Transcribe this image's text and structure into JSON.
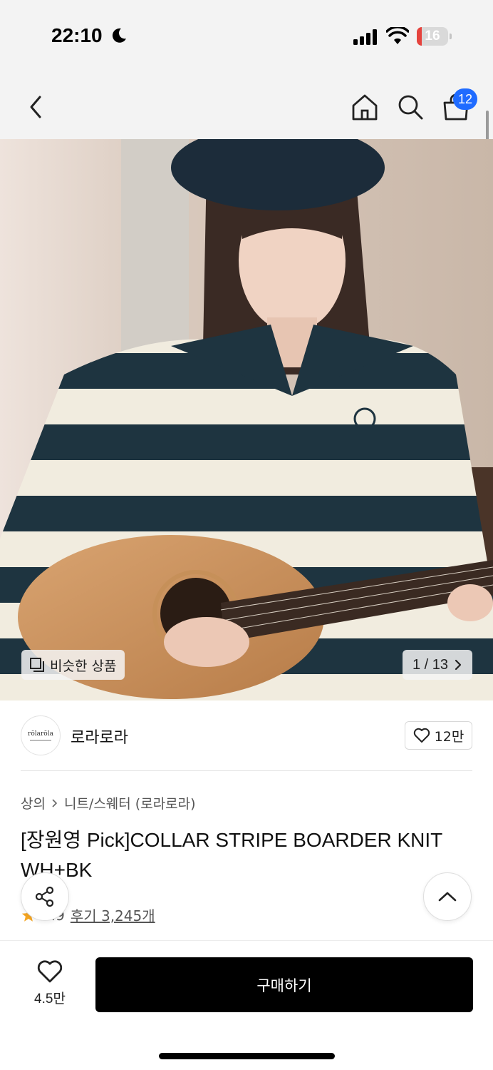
{
  "status_bar": {
    "time": "22:10",
    "battery": "16",
    "battery_level": 0.16
  },
  "header": {
    "cart_count": "12"
  },
  "gallery": {
    "similar_label": "비슷한 상품",
    "page_indicator": "1 / 13"
  },
  "brand": {
    "logo_text": "rōlarōla",
    "name": "로라로라",
    "likes": "12만"
  },
  "product": {
    "breadcrumb": [
      "상의",
      "니트/스웨터 (로라로라)"
    ],
    "title": "[장원영 Pick]COLLAR STRIPE BOARDER KNIT WH+BK",
    "rating": "4.9",
    "reviews": "후기 3,245개"
  },
  "bottom": {
    "wish_count": "4.5만",
    "buy_label": "구매하기"
  },
  "colors": {
    "accent_badge": "#1f6bff",
    "star": "#f5a623",
    "buy_button": "#000000"
  },
  "icons": [
    "moon-icon",
    "signal-icon",
    "wifi-icon",
    "back-icon",
    "home-icon",
    "search-icon",
    "cart-icon",
    "similar-icon",
    "chevron-right-icon",
    "heart-icon",
    "share-icon",
    "chevron-up-icon",
    "star-icon"
  ]
}
